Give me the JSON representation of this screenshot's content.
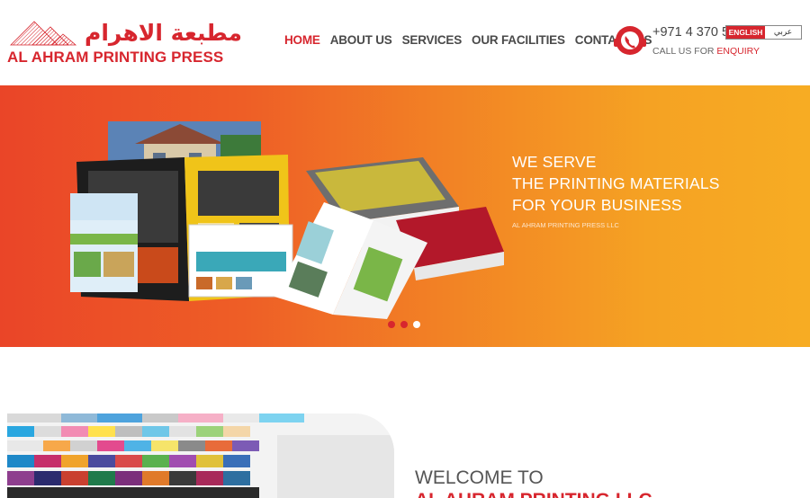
{
  "logo": {
    "arabic": "مطبعة الاهرام",
    "english": "AL AHRAM PRINTING PRESS"
  },
  "nav": {
    "items": [
      {
        "label": "HOME",
        "active": true
      },
      {
        "label": "ABOUT US"
      },
      {
        "label": "SERVICES"
      },
      {
        "label": "OUR FACILITIES"
      },
      {
        "label": "CONTACT US"
      }
    ]
  },
  "contact": {
    "phone": "+971 4 370 5",
    "enquiry_prefix": "CALL US FOR ",
    "enquiry_highlight": "ENQUIRY"
  },
  "language": {
    "english": "ENGLISH",
    "arabic": "عربي"
  },
  "hero": {
    "line1": "WE SERVE",
    "line2": "THE PRINTING MATERIALS",
    "line3": "FOR YOUR BUSINESS",
    "company": "AL AHRAM PRINTING PRESS LLC",
    "slides": 3,
    "active_slide": 3
  },
  "welcome": {
    "title": "WELCOME TO",
    "subtitle": "AL AHRAM PRINTING LLC"
  },
  "colors": {
    "brand_red": "#d7262e",
    "hero_start": "#ea4528",
    "hero_end": "#f7ac23"
  }
}
